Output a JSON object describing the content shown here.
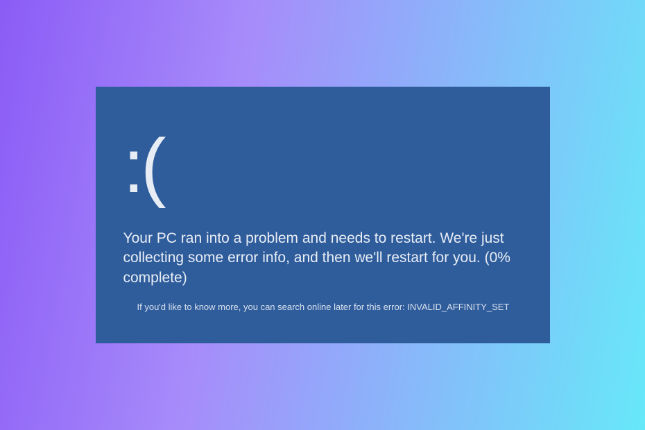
{
  "bsod": {
    "sad_face": ":(",
    "main_message": "Your PC ran into a problem and needs to restart. We're just collecting some error info, and then we'll restart for you. (0% complete)",
    "info_prefix": "If you'd like to know more, you can search online later for this error: ",
    "error_code": "INVALID_AFFINITY_SET",
    "colors": {
      "bsod_background": "#2f5d9c",
      "text": "#e8edf5",
      "page_gradient_start": "#8b5cf6",
      "page_gradient_end": "#67e8f9"
    }
  }
}
